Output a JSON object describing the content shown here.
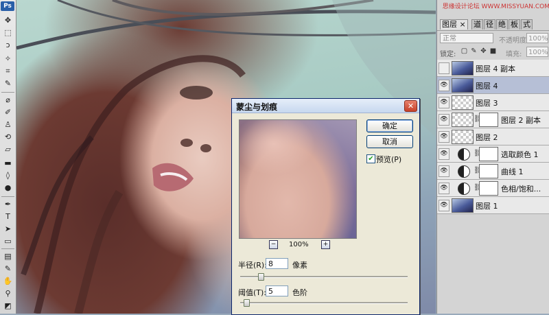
{
  "app": {
    "logo": "Ps"
  },
  "toolbar": {
    "tools": [
      {
        "name": "move-tool-icon",
        "glyph": "✥"
      },
      {
        "name": "marquee-tool-icon",
        "glyph": "⬚"
      },
      {
        "name": "lasso-tool-icon",
        "glyph": "ↄ"
      },
      {
        "name": "magic-wand-tool-icon",
        "glyph": "✧"
      },
      {
        "name": "crop-tool-icon",
        "glyph": "⌗"
      },
      {
        "name": "eyedropper-tool-icon",
        "glyph": "✎"
      },
      {
        "name": "healing-brush-tool-icon",
        "glyph": "⌀"
      },
      {
        "name": "brush-tool-icon",
        "glyph": "✐"
      },
      {
        "name": "clone-stamp-tool-icon",
        "glyph": "♙"
      },
      {
        "name": "history-brush-tool-icon",
        "glyph": "⟲"
      },
      {
        "name": "eraser-tool-icon",
        "glyph": "▱"
      },
      {
        "name": "gradient-tool-icon",
        "glyph": "▬"
      },
      {
        "name": "blur-tool-icon",
        "glyph": "◊"
      },
      {
        "name": "dodge-tool-icon",
        "glyph": "●"
      },
      {
        "name": "pen-tool-icon",
        "glyph": "✒"
      },
      {
        "name": "type-tool-icon",
        "glyph": "T"
      },
      {
        "name": "path-selection-tool-icon",
        "glyph": "➤"
      },
      {
        "name": "shape-tool-icon",
        "glyph": "▭"
      },
      {
        "name": "notes-tool-icon",
        "glyph": "▤"
      },
      {
        "name": "measure-eyedropper-tool-icon",
        "glyph": "✎"
      },
      {
        "name": "hand-tool-icon",
        "glyph": "✋"
      },
      {
        "name": "zoom-tool-icon",
        "glyph": "⚲"
      },
      {
        "name": "color-swatches-icon",
        "glyph": "◩"
      }
    ]
  },
  "dialog": {
    "title": "蒙尘与划痕",
    "close_glyph": "✕",
    "ok_label": "确定",
    "cancel_label": "取消",
    "preview_checked_glyph": "✔",
    "preview_label": "预览(P)",
    "zoom_out_glyph": "−",
    "zoom_in_glyph": "+",
    "zoom_level": "100%",
    "radius": {
      "label": "半径(R):",
      "value": "8",
      "unit": "像素",
      "slider_fraction": 0.11
    },
    "threshold": {
      "label": "阈值(T):",
      "value": "5",
      "unit": "色阶",
      "slider_fraction": 0.02
    }
  },
  "layers_panel": {
    "watermark": "思缘设计论坛 WWW.MISSYUAN.COM",
    "tabs": [
      "图层 ×",
      "道",
      "径",
      "绝",
      "板",
      "式"
    ],
    "blend_mode": "正常",
    "opacity_label": "不透明度:",
    "opacity_value": "100%",
    "lock_label": "锁定:",
    "fill_label": "填充:",
    "fill_value": "100%",
    "eye_glyph": "👁",
    "chain_glyph": "⛓",
    "layers": [
      {
        "name": "图层 4 副本",
        "visible": false,
        "thumb": "photo",
        "selected": false,
        "mask": false
      },
      {
        "name": "图层 4",
        "visible": true,
        "thumb": "photo",
        "selected": true,
        "mask": false
      },
      {
        "name": "图层 3",
        "visible": true,
        "thumb": "empty",
        "selected": false,
        "mask": false
      },
      {
        "name": "图层 2 副本",
        "visible": true,
        "thumb": "empty",
        "selected": false,
        "mask": true
      },
      {
        "name": "图层 2",
        "visible": true,
        "thumb": "empty",
        "selected": false,
        "mask": false
      },
      {
        "name": "选取颜色 1",
        "visible": true,
        "thumb": "adjust",
        "selected": false,
        "mask": true
      },
      {
        "name": "曲线 1",
        "visible": true,
        "thumb": "adjust",
        "selected": false,
        "mask": true
      },
      {
        "name": "色相/饱和...",
        "visible": true,
        "thumb": "adjust",
        "selected": false,
        "mask": true
      },
      {
        "name": "图层 1",
        "visible": true,
        "thumb": "photo",
        "selected": false,
        "mask": false
      }
    ]
  }
}
